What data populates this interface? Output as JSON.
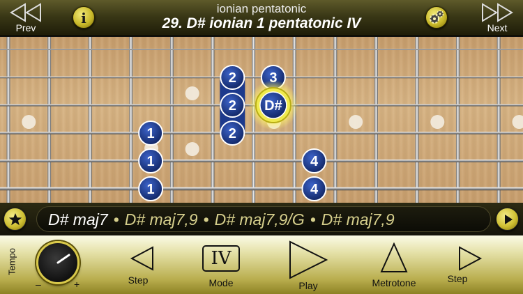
{
  "header": {
    "prev_label": "Prev",
    "next_label": "Next",
    "info_glyph": "i",
    "subtitle": "ionian pentatonic",
    "title": "29. D# ionian 1 pentatonic IV",
    "icons": {
      "prev": "double-left-arrow",
      "next": "double-right-arrow",
      "info": "info-icon",
      "settings": "gears-icon"
    }
  },
  "fretboard": {
    "root_note": "D#",
    "notes": [
      {
        "string": 1,
        "fret": 6,
        "label": "2"
      },
      {
        "string": 1,
        "fret": 7,
        "label": "3"
      },
      {
        "string": 2,
        "fret": 6,
        "label": "2"
      },
      {
        "string": 2,
        "fret": 7,
        "label": "D#",
        "root": true
      },
      {
        "string": 3,
        "fret": 4,
        "label": "1"
      },
      {
        "string": 3,
        "fret": 6,
        "label": "2"
      },
      {
        "string": 4,
        "fret": 4,
        "label": "1"
      },
      {
        "string": 4,
        "fret": 8,
        "label": "4"
      },
      {
        "string": 5,
        "fret": 4,
        "label": "1"
      },
      {
        "string": 5,
        "fret": 8,
        "label": "4"
      }
    ],
    "colors": {
      "note": "#1d3a8c",
      "root_ring": "#e8e24a",
      "wood": "#d4ae7e"
    }
  },
  "chord_bar": {
    "chords": [
      "D# maj7",
      "D# maj7,9",
      "D# maj7,9/G",
      "D# maj7,9"
    ],
    "separator": "•",
    "icons": {
      "favorite": "star-icon",
      "next": "play-right-icon"
    }
  },
  "controls": {
    "tempo_label": "Tempo",
    "tempo_minus": "–",
    "tempo_plus": "+",
    "step_back_label": "Step",
    "mode_value": "IV",
    "mode_label": "Mode",
    "play_label": "Play",
    "metronome_label": "Metrotone",
    "step_fwd_label": "Step",
    "accent_color": "#d9c94a"
  }
}
